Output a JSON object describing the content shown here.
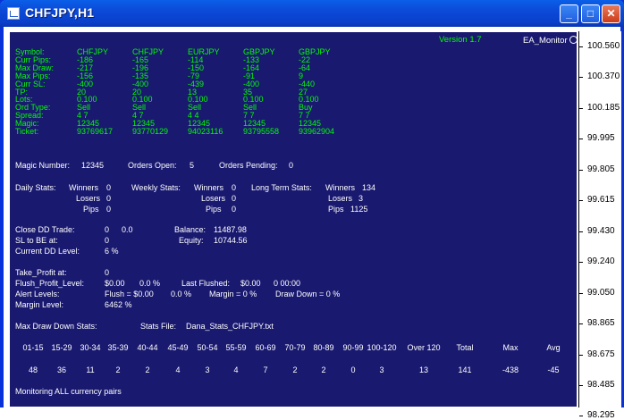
{
  "window": {
    "title": "CHFJPY,H1"
  },
  "header": {
    "version": "Version  1.7",
    "ea_name": "EA_Monitor"
  },
  "symbols": {
    "row_labels": [
      "Symbol:",
      "Curr Pips:",
      "Max Draw:",
      "Max Pips:",
      "Curr SL:",
      "TP:",
      "Lots:",
      "Ord Type:",
      "Spread:",
      "Magic:",
      "Ticket:"
    ],
    "columns": [
      [
        "CHFJPY",
        "-186",
        "-217",
        "-156",
        "-400",
        "20",
        "0.100",
        "Sell",
        "4   7",
        "12345",
        "93769617"
      ],
      [
        "CHFJPY",
        "-165",
        "-196",
        "-135",
        "-400",
        "20",
        "0.100",
        "Sell",
        "4   7",
        "12345",
        "93770129"
      ],
      [
        "EURJPY",
        "-114",
        "-150",
        "-79",
        "-439",
        "13",
        "0.100",
        "Sell",
        "4   4",
        "12345",
        "94023116"
      ],
      [
        "GBPJPY",
        "-133",
        "-164",
        "-91",
        "-400",
        "35",
        "0.100",
        "Sell",
        "7   7",
        "12345",
        "93795558"
      ],
      [
        "GBPJPY",
        "-22",
        "-64",
        "9",
        "-440",
        "27",
        "0.100",
        "Buy",
        "7   7",
        "12345",
        "93962904"
      ]
    ]
  },
  "summary": {
    "magic_label": "Magic Number:",
    "magic_value": "12345",
    "orders_open_label": "Orders Open:",
    "orders_open_value": "5",
    "orders_pending_label": "Orders Pending:",
    "orders_pending_value": "0"
  },
  "stats": {
    "daily_label": "Daily Stats:",
    "weekly_label": "Weekly Stats:",
    "longterm_label": "Long Term Stats:",
    "winners_label": "Winners",
    "losers_label": "Losers",
    "pips_label": "Pips",
    "daily": {
      "winners": "0",
      "losers": "0",
      "pips": "0"
    },
    "weekly": {
      "winners": "0",
      "losers": "0",
      "pips": "0"
    },
    "longterm": {
      "winners": "134",
      "losers": "3",
      "pips": "1125"
    }
  },
  "dd": {
    "close_dd_label": "Close DD Trade:",
    "close_dd_a": "0",
    "close_dd_b": "0.0",
    "sl_be_label": "SL to BE at:",
    "sl_be_value": "0",
    "current_dd_label": "Current DD Level:",
    "current_dd_value": "6 %",
    "balance_label": "Balance:",
    "balance_value": "11487.98",
    "equity_label": "Equity:",
    "equity_value": "10744.56"
  },
  "profit": {
    "take_profit_label": "Take_Profit at:",
    "take_profit_value": "0",
    "flush_label": "Flush_Profit_Level:",
    "flush_a": "$0.00",
    "flush_b": "0.0 %",
    "last_flushed_label": "Last Flushed:",
    "last_flushed_a": "$0.00",
    "last_flushed_b": "0   00:00",
    "alert_label": "Alert Levels:",
    "alert_flush": "Flush = $0.00",
    "alert_flush_pct": "0.0 %",
    "alert_margin": "Margin = 0 %",
    "alert_drawdown": "Draw Down = 0 %",
    "margin_label": "Margin Level:",
    "margin_value": "6462 %"
  },
  "stats_file": {
    "maxdd_label": "Max Draw Down Stats:",
    "file_label": "Stats File:",
    "file_value": "Dana_Stats_CHFJPY.txt"
  },
  "histogram": {
    "headers": [
      "01-15",
      "15-29",
      "30-34",
      "35-39",
      "40-44",
      "45-49",
      "50-54",
      "55-59",
      "60-69",
      "70-79",
      "80-89",
      "90-99",
      "100-120",
      "Over 120",
      "Total",
      "Max",
      "Avg"
    ],
    "values": [
      "48",
      "36",
      "11",
      "2",
      "2",
      "4",
      "3",
      "4",
      "7",
      "2",
      "2",
      "0",
      "3",
      "13",
      "141",
      "-438",
      "-45"
    ]
  },
  "footer": {
    "monitoring": "Monitoring ALL currency pairs"
  },
  "price_axis": [
    "100.560",
    "100.370",
    "100.185",
    "99.995",
    "99.805",
    "99.615",
    "99.430",
    "99.240",
    "99.050",
    "98.865",
    "98.675",
    "98.485",
    "98.295"
  ],
  "colors": {
    "chart_bg": "#191970",
    "green_text": "#00ff00",
    "white_text": "#ffffff",
    "titlebar": "#0b4ad8"
  }
}
